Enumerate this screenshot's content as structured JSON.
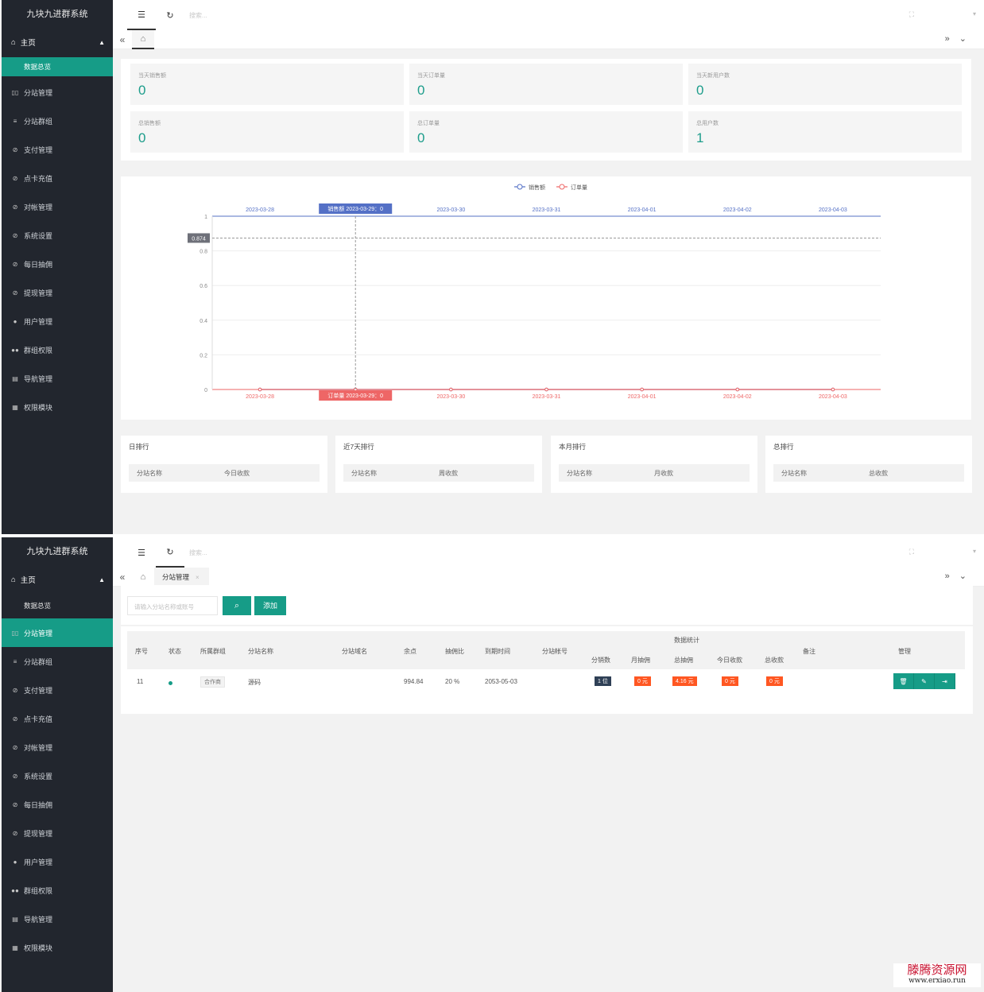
{
  "brand_title": "九块九进群系统",
  "topbar": {
    "search_placeholder": "搜索..."
  },
  "sidebar": {
    "home": "主页",
    "overview": "数据总览",
    "items": [
      {
        "label": "分站管理",
        "icon": "grid-icon"
      },
      {
        "label": "分站群组",
        "icon": "sliders-icon"
      },
      {
        "label": "支付管理",
        "icon": "shield-check-icon"
      },
      {
        "label": "点卡充值",
        "icon": "shield-check-icon"
      },
      {
        "label": "对帐管理",
        "icon": "shield-check-icon"
      },
      {
        "label": "系统设置",
        "icon": "shield-check-icon"
      },
      {
        "label": "每日抽佣",
        "icon": "shield-check-icon"
      },
      {
        "label": "提现管理",
        "icon": "shield-check-icon"
      },
      {
        "label": "用户管理",
        "icon": "user-icon"
      },
      {
        "label": "群组权限",
        "icon": "users-icon"
      },
      {
        "label": "导航管理",
        "icon": "nav-icon"
      },
      {
        "label": "权限模块",
        "icon": "module-icon"
      }
    ]
  },
  "stats": [
    {
      "label": "当天销售额",
      "value": "0"
    },
    {
      "label": "当天订单量",
      "value": "0"
    },
    {
      "label": "当天新用户数",
      "value": "0"
    },
    {
      "label": "总销售额",
      "value": "0"
    },
    {
      "label": "总订单量",
      "value": "0"
    },
    {
      "label": "总用户数",
      "value": "1"
    }
  ],
  "chart_data": {
    "type": "line",
    "x": [
      "2023-03-28",
      "2023-03-29",
      "2023-03-30",
      "2023-03-31",
      "2023-04-01",
      "2023-04-02",
      "2023-04-03"
    ],
    "x_tick_labels": [
      "2023-03-28",
      "2023-03-30",
      "2023-03-31",
      "2023-04-01",
      "2023-04-02",
      "2023-04-03"
    ],
    "series": [
      {
        "name": "销售额",
        "color": "#5470c6",
        "values": [
          0,
          0,
          0,
          0,
          0,
          0,
          0
        ]
      },
      {
        "name": "订单量",
        "color": "#ee6666",
        "values": [
          0,
          0,
          0,
          0,
          0,
          0,
          0
        ]
      }
    ],
    "y_ticks": [
      "1",
      "0.8",
      "0.6",
      "0.4",
      "0.2",
      "0"
    ],
    "ylim": [
      0,
      1
    ],
    "legend": "top-center",
    "crosshair": {
      "x": "2023-03-29",
      "y_label": "0.874",
      "top_label": "销售额  2023-03-29：0",
      "bottom_label": "订单量  2023-03-29：0"
    }
  },
  "rankings": [
    {
      "title": "日排行",
      "col1": "分站名称",
      "col2": "今日收款"
    },
    {
      "title": "近7天排行",
      "col1": "分站名称",
      "col2": "周收款"
    },
    {
      "title": "本月排行",
      "col1": "分站名称",
      "col2": "月收款"
    },
    {
      "title": "总排行",
      "col1": "分站名称",
      "col2": "总收款"
    }
  ],
  "page2": {
    "tab_label": "分站管理",
    "search_placeholder": "请输入分站名称或账号",
    "add_label": "添加",
    "headers": {
      "no": "序号",
      "status": "状态",
      "group": "所属群组",
      "name": "分站名称",
      "domain": "分站域名",
      "balance": "余点",
      "ratio": "抽佣比",
      "expire": "到期时间",
      "account": "分站帐号",
      "stats_group": "数据统计",
      "dist": "分销数",
      "month": "月抽佣",
      "total": "总抽佣",
      "today_in": "今日收款",
      "total_in": "总收款",
      "remark": "备注",
      "manage": "管理"
    },
    "row": {
      "no": "11",
      "group": "合作商",
      "name": "源码",
      "balance": "994.84",
      "ratio": "20 %",
      "expire": "2053-05-03",
      "dist": "1 位",
      "month": "0 元",
      "total": "4.16 元",
      "today_in": "0 元",
      "total_in": "0 元"
    }
  },
  "watermark": {
    "line1": "滕腾资源网",
    "line2": "www.erxiao.run"
  }
}
